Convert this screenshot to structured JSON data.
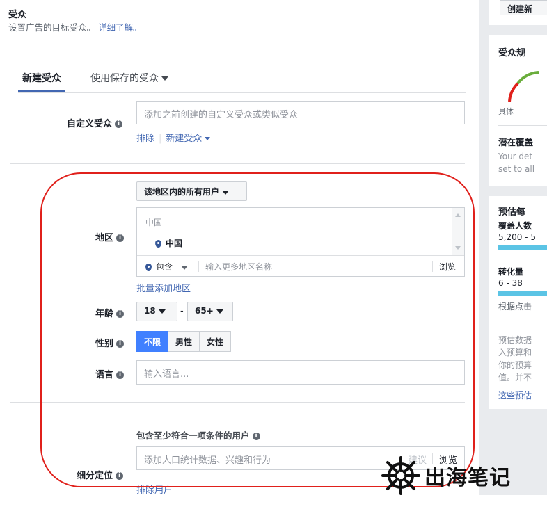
{
  "header": {
    "title": "受众",
    "subtitle": "设置广告的目标受众。",
    "learn_more": "详细了解。"
  },
  "tabs": [
    {
      "label": "新建受众",
      "active": true
    },
    {
      "label": "使用保存的受众",
      "active": false
    }
  ],
  "custom_audience": {
    "label": "自定义受众",
    "placeholder": "添加之前创建的自定义受众或类似受众",
    "exclude": "排除",
    "new_audience": "新建受众"
  },
  "location": {
    "filter": "该地区内的所有用户",
    "label": "地区",
    "country": "中国",
    "selected": "中国",
    "include": "包含",
    "input_placeholder": "输入更多地区名称",
    "browse": "浏览",
    "bulk_add": "批量添加地区"
  },
  "age": {
    "label": "年龄",
    "min": "18",
    "max": "65+",
    "dash": "-"
  },
  "gender": {
    "label": "性别",
    "options": [
      "不限",
      "男性",
      "女性"
    ],
    "selected": "不限"
  },
  "language": {
    "label": "语言",
    "placeholder": "输入语言..."
  },
  "detailed": {
    "header": "包含至少符合一项条件的用户",
    "label": "细分定位",
    "placeholder": "添加人口统计数据、兴趣和行为",
    "suggest": "建议",
    "browse": "浏览",
    "exclude": "排除用户"
  },
  "right": {
    "create_button": "创建新",
    "audience_size_title": "受众规",
    "specific": "具体",
    "potential_reach": "潜在覆盖",
    "your_det": "Your det",
    "set_to_all": "set to all",
    "estimate_title": "预估每",
    "reach_label": "覆盖人数",
    "reach_value": "5,200 - 5",
    "conversions_label": "转化量",
    "conversions_value": "6 - 38",
    "based_on": "根据点击",
    "estimate_note_1": "预估数据",
    "estimate_note_2": "入预算和",
    "estimate_note_3": "你的预算",
    "estimate_note_4": "值。并不",
    "these_estimates": "这些预估"
  },
  "watermark": {
    "text": "出海笔记"
  },
  "colors": {
    "accent": "#4267b2",
    "selected_segment": "#4080ff",
    "highlight_outline": "#e0201b",
    "reach_bar": "#5bc4e5"
  }
}
